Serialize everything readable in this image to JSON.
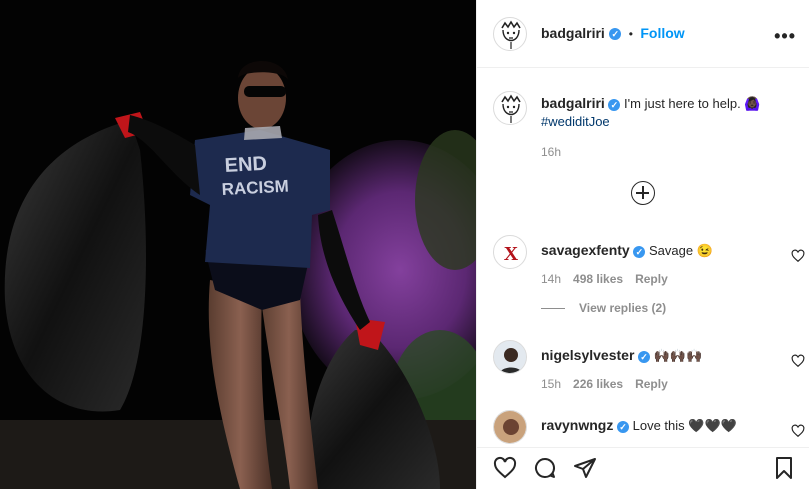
{
  "post": {
    "username": "badgalriri",
    "follow_label": "Follow",
    "separator": "•",
    "more_icon": "more-horizontal-icon"
  },
  "caption": {
    "username": "badgalriri",
    "text": "I'm just here to help. 🙆🏿‍♀️",
    "hashtag": "#wedidit",
    "hashtag_rest": "Joe",
    "time": "16h"
  },
  "comments": [
    {
      "username": "savagexfenty",
      "text": "Savage 😉",
      "time": "14h",
      "likes": "498 likes",
      "reply": "Reply",
      "avatar_letter": "X"
    },
    {
      "username": "nigelsylvester",
      "text": "🙌🏿🙌🏿🙌🏿",
      "time": "15h",
      "likes": "226 likes",
      "reply": "Reply"
    },
    {
      "username": "ravynwngz",
      "text": "Love this 🖤🖤🖤"
    }
  ],
  "view_replies": "View replies (2)",
  "colors": {
    "accent": "#0095f6",
    "verified": "#3897f0",
    "muted": "#8e8e8e",
    "text": "#262626"
  },
  "actions": [
    "heart-icon",
    "comment-icon",
    "share-icon",
    "bookmark-icon"
  ],
  "photo": {
    "shirt_text_1": "END",
    "shirt_text_2": "RACISM"
  }
}
